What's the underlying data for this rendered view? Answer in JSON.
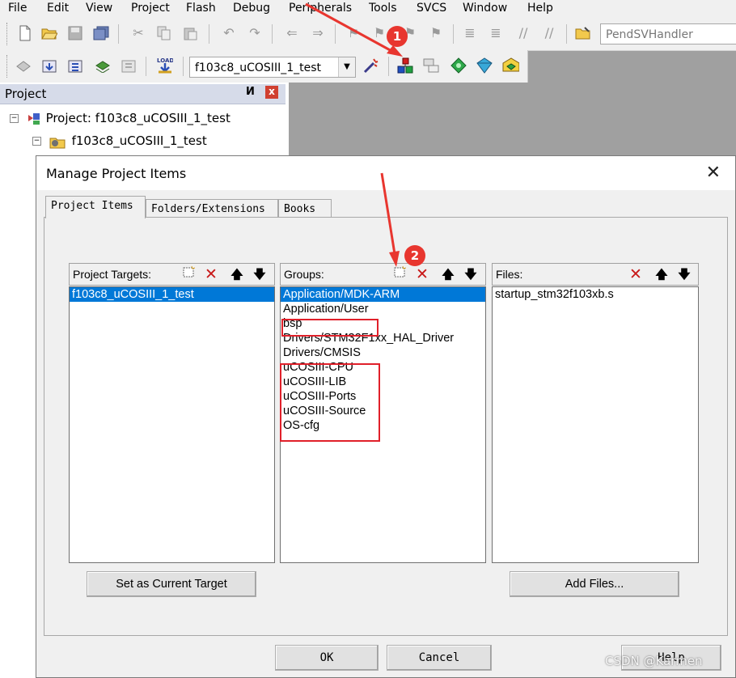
{
  "menu": [
    "File",
    "Edit",
    "View",
    "Project",
    "Flash",
    "Debug",
    "Peripherals",
    "Tools",
    "SVCS",
    "Window",
    "Help"
  ],
  "toolbar": {
    "function_combo": "PendSVHandler",
    "target_combo": "f103c8_uCOSIII_1_test",
    "load_label": "LOAD"
  },
  "project_pane": {
    "title": "Project",
    "pin_glyph": "И",
    "close_glyph": "x",
    "root": "Project: f103c8_uCOSIII_1_test",
    "target": "f103c8_uCOSIII_1_test"
  },
  "dialog": {
    "title": "Manage Project Items",
    "tabs": [
      "Project Items",
      "Folders/Extensions",
      "Books"
    ],
    "targets": {
      "title": "Project Targets:",
      "items": [
        "f103c8_uCOSIII_1_test"
      ],
      "selected_index": 0
    },
    "groups": {
      "title": "Groups:",
      "items": [
        "Application/MDK-ARM",
        "Application/User",
        "bsp",
        "Drivers/STM32F1xx_HAL_Driver",
        "Drivers/CMSIS",
        "uCOSIII-CPU",
        "uCOSIII-LIB",
        "uCOSIII-Ports",
        "uCOSIII-Source",
        "OS-cfg"
      ],
      "selected_index": 0
    },
    "files": {
      "title": "Files:",
      "items": [
        "startup_stm32f103xb.s"
      ]
    },
    "set_current_target": "Set as Current Target",
    "add_files": "Add Files...",
    "ok": "OK",
    "cancel": "Cancel",
    "help": "Help"
  },
  "annotations": {
    "badge_1": "1",
    "badge_2": "2",
    "color": "#e0202a"
  },
  "watermark": "CSDN @Karmen"
}
